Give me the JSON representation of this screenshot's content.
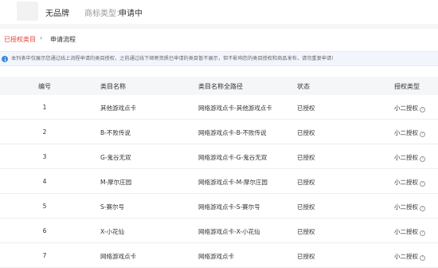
{
  "header": {
    "brand": "无品牌",
    "brand_type_label": "商标类型：",
    "brand_type_value": "申请中"
  },
  "breadcrumb": {
    "link": "已授权类目",
    "separator": "›",
    "current": "申请流程"
  },
  "notice": {
    "icon": "info-icon",
    "text": "本列表中仅展示您通过线上流程申请的类目授权，之前通过线下邮寄资质已申请的类目暂不展示，但不影响您的类目授权和商品发布，请勿重复申请!"
  },
  "table": {
    "headers": [
      "编号",
      "类目名称",
      "类目名称全路径",
      "状态",
      "授权类型"
    ],
    "rows": [
      {
        "no": "1",
        "name": "其他游戏点卡",
        "path": "网络游戏点卡-其他游戏点卡",
        "status": "已授权",
        "type": "小二授权"
      },
      {
        "no": "2",
        "name": "B-不败传说",
        "path": "网络游戏点卡-B-不败传说",
        "status": "已授权",
        "type": "小二授权"
      },
      {
        "no": "3",
        "name": "G-鬼谷无双",
        "path": "网络游戏点卡-G-鬼谷无双",
        "status": "已授权",
        "type": "小二授权"
      },
      {
        "no": "4",
        "name": "M-摩尔庄园",
        "path": "网络游戏点卡-M-摩尔庄园",
        "status": "已授权",
        "type": "小二授权"
      },
      {
        "no": "5",
        "name": "S-赛尔号",
        "path": "网络游戏点卡-S-赛尔号",
        "status": "已授权",
        "type": "小二授权"
      },
      {
        "no": "6",
        "name": "X-小花仙",
        "path": "网络游戏点卡-X-小花仙",
        "status": "已授权",
        "type": "小二授权"
      },
      {
        "no": "7",
        "name": "网络游戏点卡",
        "path": "网络游戏点卡",
        "status": "已授权",
        "type": "小二授权"
      }
    ],
    "help_icon": "question-circle-icon",
    "help_glyph": "?"
  },
  "colors": {
    "accent": "#e6453c",
    "notice_bg": "#f2f6fc",
    "info_icon": "#3d8be0",
    "header_row_bg": "#f5f6f7"
  }
}
